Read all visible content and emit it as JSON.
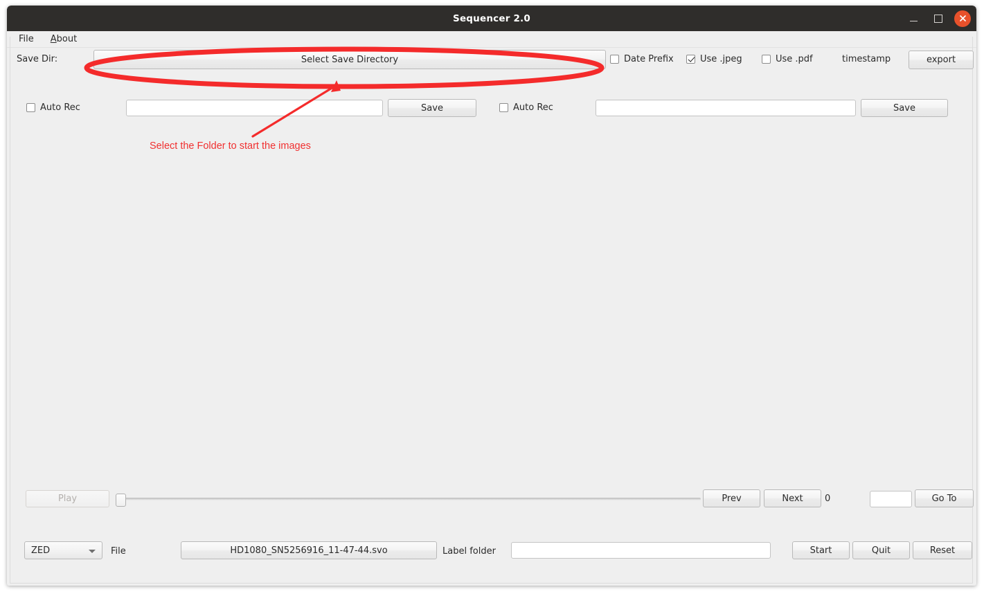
{
  "window": {
    "title": "Sequencer 2.0",
    "controls": {
      "minimize": "minimize",
      "maximize": "maximize",
      "close": "close"
    },
    "close_color": "#e8512b",
    "titlebar_color": "#2f2d2b",
    "background_color": "#efefef"
  },
  "menubar": {
    "items": [
      {
        "label": "File",
        "mnemonic": ""
      },
      {
        "label": "About",
        "mnemonic": "A"
      }
    ]
  },
  "save_dir_row": {
    "label": "Save Dir:",
    "select_button": "Select Save Directory",
    "checkboxes": [
      {
        "label": "Date Prefix",
        "checked": false
      },
      {
        "label": "Use .jpeg",
        "checked": true
      },
      {
        "label": "Use .pdf",
        "checked": false
      }
    ],
    "timestamp_label": "timestamp",
    "export_button": "export"
  },
  "auto_rec_row": {
    "left": {
      "checkbox_label": "Auto Rec",
      "checked": false,
      "input_value": "",
      "input_placeholder": "",
      "save_button": "Save"
    },
    "right": {
      "checkbox_label": "Auto Rec",
      "checked": false,
      "input_value": "",
      "input_placeholder": "",
      "save_button": "Save"
    }
  },
  "annotation": {
    "text": "Select the Folder to start the images",
    "color": "#f03030"
  },
  "playback_row": {
    "play_button": "Play",
    "play_enabled": false,
    "slider_value": 0,
    "slider_min": 0,
    "slider_max": 100,
    "prev_button": "Prev",
    "next_button": "Next",
    "frame_counter": "0",
    "goto_input_value": "",
    "goto_button": "Go To"
  },
  "bottom_row": {
    "source_dropdown": {
      "selected": "ZED",
      "options": [
        "ZED"
      ]
    },
    "file_label": "File",
    "file_name": "HD1080_SN5256916_11-47-44.svo",
    "label_folder_label": "Label folder",
    "label_folder_value": "",
    "start_button": "Start",
    "quit_button": "Quit",
    "reset_button": "Reset"
  }
}
